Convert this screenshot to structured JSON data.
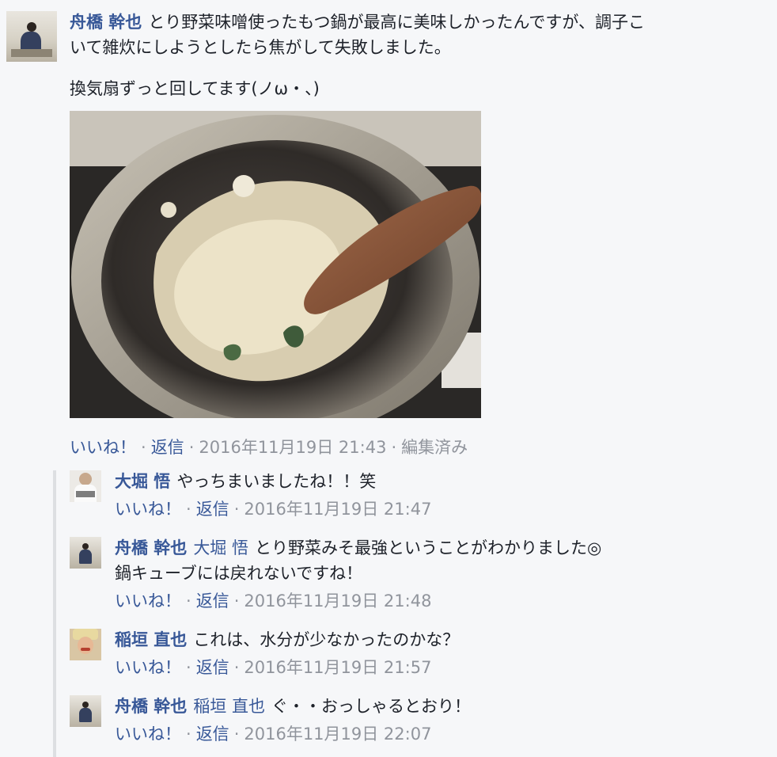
{
  "post": {
    "author": "舟橋 幹也",
    "text_line1": "とり野菜味噌使ったもつ鍋が最高に美味しかったんですが、調子こ",
    "text_line2": "いて雑炊にしようとしたら焦がして失敗しました。",
    "text_line3": "換気扇ずっと回してます(ノω・、)",
    "like_label": "いいね！",
    "reply_label": "返信",
    "timestamp": "2016年11月19日 21:43",
    "edited_label": "編集済み"
  },
  "replies": [
    {
      "author": "大堀 悟",
      "mention": "",
      "text": "やっちまいましたね！！笑",
      "text2": "",
      "like_label": "いいね！",
      "reply_label": "返信",
      "timestamp": "2016年11月19日 21:47"
    },
    {
      "author": "舟橋 幹也",
      "mention": "大堀 悟",
      "text": "とり野菜みそ最強ということがわかりました◎",
      "text2": "鍋キューブには戻れないですね！",
      "like_label": "いいね！",
      "reply_label": "返信",
      "timestamp": "2016年11月19日 21:48"
    },
    {
      "author": "稲垣 直也",
      "mention": "",
      "text": "これは、水分が少なかったのかな？",
      "text2": "",
      "like_label": "いいね！",
      "reply_label": "返信",
      "timestamp": "2016年11月19日 21:57"
    },
    {
      "author": "舟橋 幹也",
      "mention": "稲垣 直也",
      "text": "ぐ・・おっしゃるとおり！",
      "text2": "",
      "like_label": "いいね！",
      "reply_label": "返信",
      "timestamp": "2016年11月19日 22:07"
    }
  ],
  "sep": "·"
}
